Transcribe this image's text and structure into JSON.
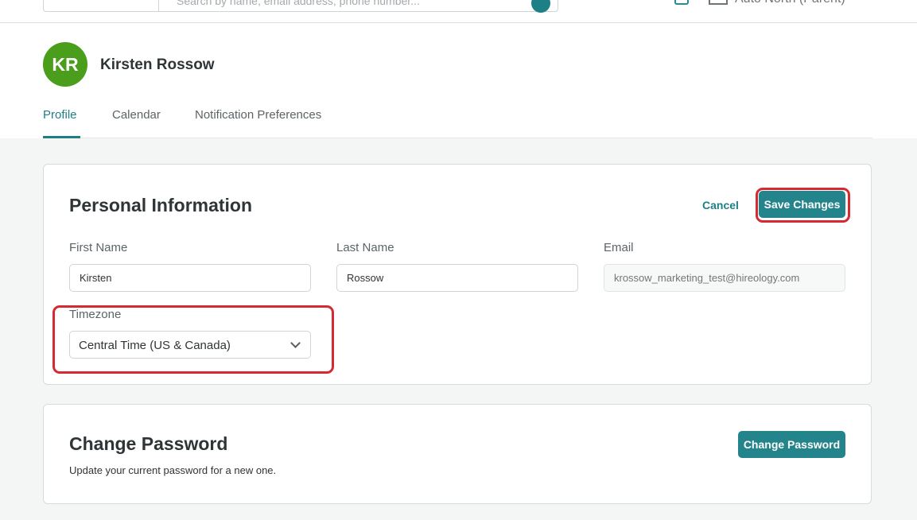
{
  "topbar": {
    "search_placeholder": "Search by name, email address, phone number...",
    "account_label": "Auto North (Parent)"
  },
  "profile": {
    "initials": "KR",
    "name": "Kirsten Rossow",
    "avatar_color": "#4a9e1c"
  },
  "tabs": [
    {
      "label": "Profile",
      "active": true
    },
    {
      "label": "Calendar",
      "active": false
    },
    {
      "label": "Notification Preferences",
      "active": false
    }
  ],
  "personal_info": {
    "title": "Personal Information",
    "cancel_label": "Cancel",
    "save_label": "Save Changes",
    "first_name": {
      "label": "First Name",
      "value": "Kirsten"
    },
    "last_name": {
      "label": "Last Name",
      "value": "Rossow"
    },
    "email": {
      "label": "Email",
      "placeholder": "krossow_marketing_test@hireology.com"
    },
    "timezone": {
      "label": "Timezone",
      "value": "Central Time (US & Canada)"
    }
  },
  "change_password": {
    "title": "Change Password",
    "description": "Update your current password for a new one.",
    "button_label": "Change Password"
  },
  "colors": {
    "accent": "#1f7f86",
    "highlight": "#d62a33"
  }
}
